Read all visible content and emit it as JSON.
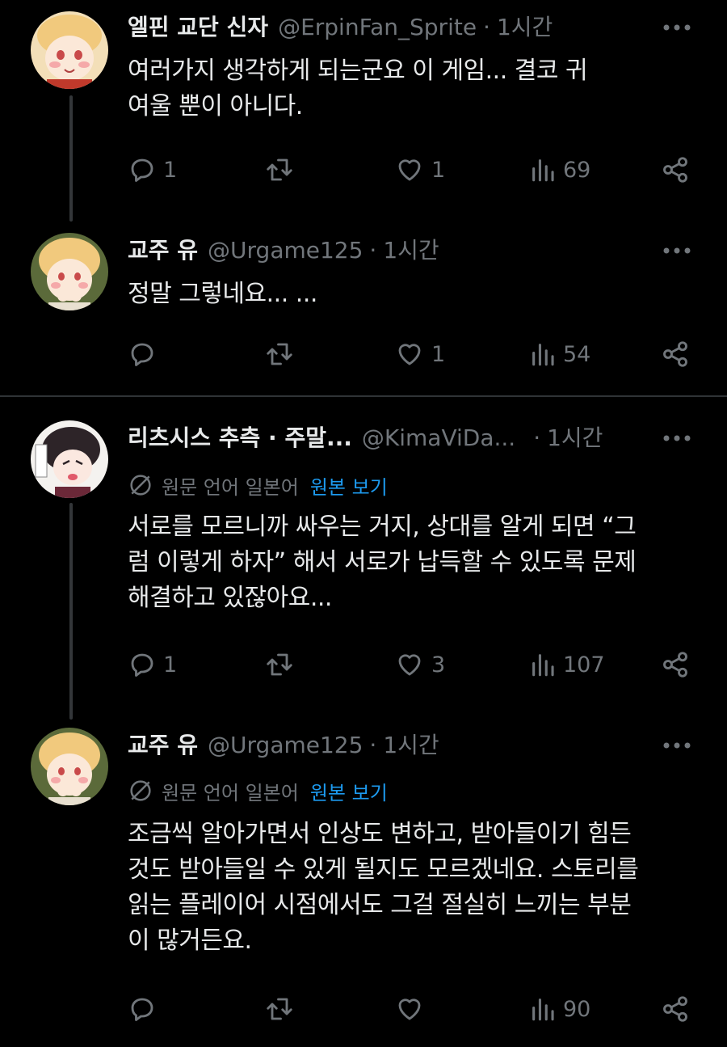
{
  "tweets": [
    {
      "name": "엘핀 교단 신자",
      "handle": "@ErpinFan_Sprite",
      "separator": "·",
      "time": "1시간",
      "lines": [
        "여러가지 생각하게 되는군요 이 게임... 결코 귀",
        "여울 뿐이 아니다."
      ],
      "replies": "1",
      "retweets": "",
      "likes": "1",
      "views": "69"
    },
    {
      "name": "교주 유",
      "handle": "@Urgame125",
      "separator": "·",
      "time": "1시간",
      "lines": [
        "정말 그렇네요... ..."
      ],
      "replies": "",
      "retweets": "",
      "likes": "1",
      "views": "54"
    },
    {
      "name": "리츠시스 추측 · 주말...",
      "handle": "@KimaViDa...",
      "separator": "·",
      "time": "1시간",
      "translate_label": "원문 언어 일본어",
      "translate_link": "원본 보기",
      "lines": [
        "서로를 모르니까 싸우는 거지, 상대를 알게 되면 “그",
        "럼 이렇게 하자” 해서 서로가 납득할 수 있도록 문제",
        "해결하고 있잖아요..."
      ],
      "replies": "1",
      "retweets": "",
      "likes": "3",
      "views": "107"
    },
    {
      "name": "교주 유",
      "handle": "@Urgame125",
      "separator": "·",
      "time": "1시간",
      "translate_label": "원문 언어 일본어",
      "translate_link": "원본 보기",
      "lines": [
        "조금씩 알아가면서 인상도 변하고, 받아들이기 힘든",
        "것도 받아들일 수 있게 될지도 모르겠네요. 스토리를",
        "읽는 플레이어 시점에서도 그걸 절실히 느끼는 부분",
        "이 많거든요."
      ],
      "replies": "",
      "retweets": "",
      "likes": "",
      "views": "90"
    }
  ],
  "icons": {
    "reply": "reply-icon",
    "retweet": "retweet-icon",
    "like": "heart-icon",
    "views": "views-icon",
    "share": "share-icon",
    "more": "more-icon",
    "translate": "translate-icon"
  },
  "colors": {
    "background": "#000000",
    "text": "#e7e9ea",
    "secondary": "#71767b",
    "link": "#1d9bf0",
    "divider": "#2f3336"
  }
}
